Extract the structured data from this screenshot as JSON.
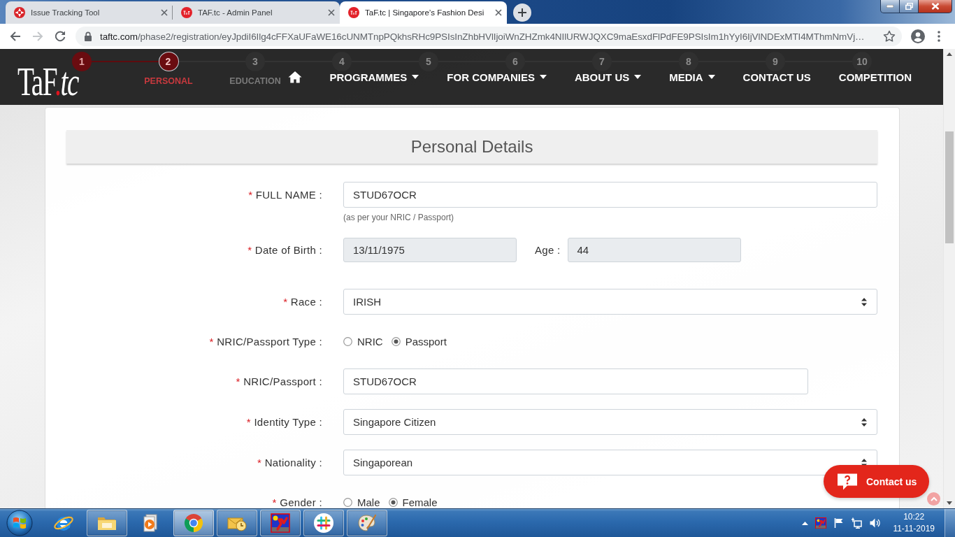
{
  "browser": {
    "tabs": [
      {
        "kind": "compass",
        "title": "Issue Tracking Tool",
        "selected": false
      },
      {
        "kind": "logo",
        "title": "TAF.tc - Admin Panel",
        "selected": false
      },
      {
        "kind": "logo",
        "title": "TaF.tc | Singapore’s Fashion Desi",
        "selected": true
      }
    ],
    "toolbar": [
      {
        "kind": "back",
        "disabled": false
      },
      {
        "kind": "forward",
        "disabled": true
      },
      {
        "kind": "reload",
        "disabled": false
      }
    ],
    "address": {
      "host": "taftc.com",
      "path": "/phase2/registration/eyJpdiI6Ilg4cFFXaUFaWE16cUNMTnpPQkhsRHc9PSIsInZhbHVlIjoiWnZHZmk4NIlURWJQXC9maEsxdFlPdFE9PSIsIm1hYyI6IjVlNDExMTI4MThmNmVj…"
    }
  },
  "site": {
    "logo": {
      "lead": "TaF",
      "dot": ".",
      "tail": "tc"
    },
    "steps": [
      {
        "number": "1",
        "completed": true,
        "selected": false
      },
      {
        "number": "2",
        "label": "PERSONAL",
        "completed": false,
        "selected": true
      },
      {
        "number": "3",
        "label": "EDUCATION",
        "completed": false,
        "selected": false
      },
      {
        "number": "4",
        "completed": false,
        "selected": false
      },
      {
        "number": "5",
        "completed": false,
        "selected": false
      },
      {
        "number": "6",
        "completed": false,
        "selected": false
      },
      {
        "number": "7",
        "completed": false,
        "selected": false
      },
      {
        "number": "8",
        "completed": false,
        "selected": false
      },
      {
        "number": "9",
        "completed": false,
        "selected": false
      },
      {
        "number": "10",
        "completed": false,
        "selected": false
      }
    ],
    "nav": [
      {
        "kind": "home"
      },
      {
        "kind": "link",
        "label": "PROGRAMMES",
        "dropdown": true
      },
      {
        "kind": "link",
        "label": "FOR COMPANIES",
        "dropdown": true
      },
      {
        "kind": "link",
        "label": "ABOUT US",
        "dropdown": true
      },
      {
        "kind": "link",
        "label": "MEDIA",
        "dropdown": true
      },
      {
        "kind": "link",
        "label": "CONTACT US",
        "dropdown": false
      },
      {
        "kind": "link",
        "label": "COMPETITION",
        "dropdown": false
      }
    ]
  },
  "form": {
    "title": "Personal Details",
    "fields": [
      {
        "kind": "text",
        "required_mark": "*",
        "label": "FULL NAME :",
        "value": "STUD67OCR",
        "readonly": false,
        "hint": "(as per your NRIC / Passport)"
      },
      {
        "kind": "date_age",
        "required_mark": "*",
        "label": "Date of Birth :",
        "value": "13/11/1975",
        "readonly": true,
        "side_label": "Age :",
        "side_value": "44",
        "side_readonly": true
      },
      {
        "kind": "select",
        "required_mark": "*",
        "label": "Race :",
        "value": "IRISH"
      },
      {
        "kind": "radio",
        "required_mark": "*",
        "label": "NRIC/Passport Type :",
        "options": [
          {
            "label": "NRIC",
            "selected": false
          },
          {
            "label": "Passport",
            "selected": true
          }
        ]
      },
      {
        "kind": "short_text",
        "required_mark": "*",
        "label": "NRIC/Passport :",
        "value": "STUD67OCR",
        "readonly": false
      },
      {
        "kind": "select",
        "required_mark": "*",
        "label": "Identity Type :",
        "value": "Singapore Citizen"
      },
      {
        "kind": "select",
        "required_mark": "*",
        "label": "Nationality :",
        "value": "Singaporean"
      },
      {
        "kind": "radio",
        "required_mark": "*",
        "label": "Gender :",
        "options": [
          {
            "label": "Male",
            "selected": false
          },
          {
            "label": "Female",
            "selected": true
          }
        ]
      }
    ]
  },
  "contact_button": {
    "label": "Contact us"
  },
  "taskbar": {
    "items": [
      {
        "kind": "globe",
        "running": false,
        "active": false
      },
      {
        "kind": "folder",
        "running": true,
        "active": false
      },
      {
        "kind": "player",
        "running": false,
        "active": false
      },
      {
        "kind": "wheel",
        "running": true,
        "active": true
      },
      {
        "kind": "mail",
        "running": true,
        "active": false
      },
      {
        "kind": "figure",
        "running": true,
        "active": false
      },
      {
        "kind": "hash",
        "running": true,
        "active": false
      },
      {
        "kind": "palette",
        "running": true,
        "active": false
      }
    ],
    "time": "10:22",
    "date": "11-11-2019"
  }
}
